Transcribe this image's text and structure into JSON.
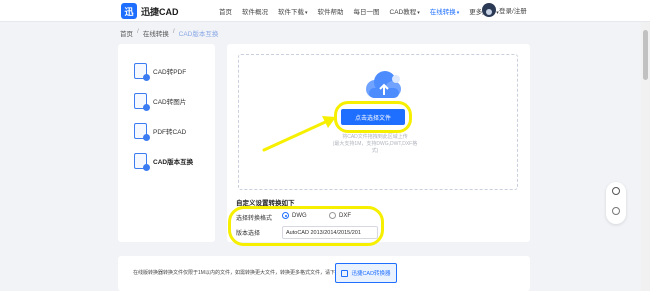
{
  "header": {
    "logo_mark": "迅",
    "logo_text": "迅捷CAD",
    "nav": [
      {
        "label": "首页",
        "caret": false,
        "active": false
      },
      {
        "label": "软件概况",
        "caret": false,
        "active": false
      },
      {
        "label": "软件下载",
        "caret": true,
        "active": false
      },
      {
        "label": "软件帮助",
        "caret": false,
        "active": false
      },
      {
        "label": "每日一图",
        "caret": false,
        "active": false
      },
      {
        "label": "CAD教程",
        "caret": true,
        "active": false
      },
      {
        "label": "在线转换",
        "caret": true,
        "active": true
      },
      {
        "label": "更多服务",
        "caret": true,
        "active": false
      }
    ],
    "login_label": "登录/注册"
  },
  "breadcrumb": {
    "home": "首页",
    "section": "在线转换",
    "current": "CAD版本互换",
    "separator": "/"
  },
  "sidebar": {
    "items": [
      {
        "label": "CAD转PDF",
        "active": false
      },
      {
        "label": "CAD转图片",
        "active": false
      },
      {
        "label": "PDF转CAD",
        "active": false
      },
      {
        "label": "CAD版本互换",
        "active": true
      }
    ]
  },
  "upload": {
    "button_label": "点击选择文件",
    "hint_line1": "将CAD文件拖拽到此区域上传",
    "hint_line2": "(最大支持1M，支持DWG,DWT,DXF格",
    "hint_line3": "式)"
  },
  "settings": {
    "title": "自定义设置转换如下",
    "format_label": "选择转换格式",
    "format_options": [
      "DWG",
      "DXF"
    ],
    "format_selected": "DWG",
    "version_label": "版本选择",
    "version_value": "AutoCAD 2013/2014/2015/201"
  },
  "bottom": {
    "notice": "在线版转换器转换文件仅限于1M以内的文件，如需转换更大文件，转换更多格式文件，请下载",
    "button_label": "迅捷CAD转换器"
  },
  "colors": {
    "accent": "#1e6fff",
    "highlight": "#f6f000"
  },
  "icons": {
    "float_top": "chat-icon",
    "float_bottom": "download-icon",
    "upload": "cloud-upload-icon"
  }
}
